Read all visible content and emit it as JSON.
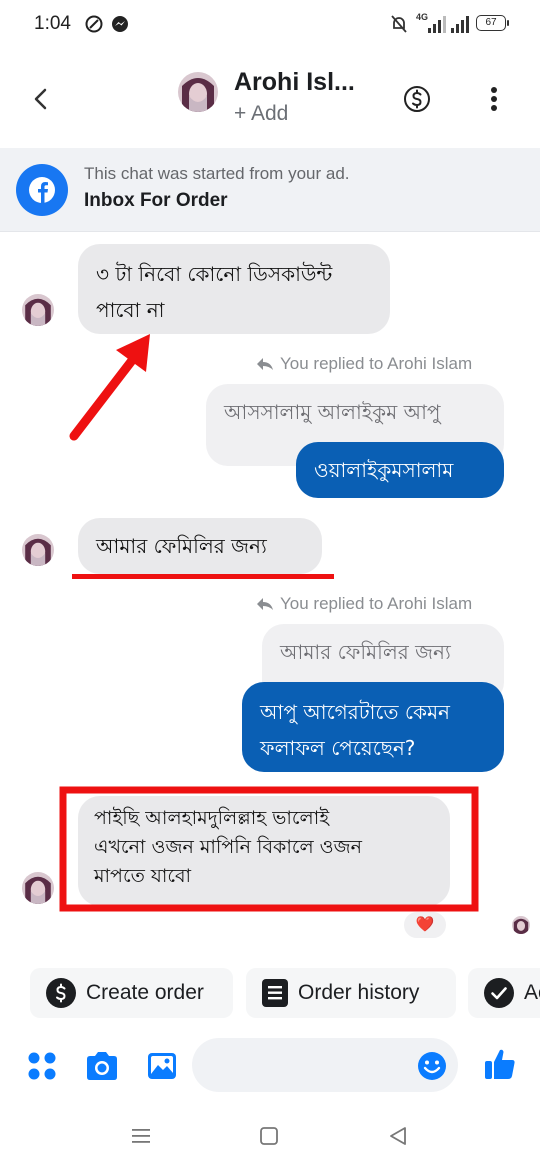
{
  "status_bar": {
    "time": "1:04",
    "network": "4G",
    "battery": "67"
  },
  "header": {
    "contact_name": "Arohi Isl...",
    "add_label": "+ Add"
  },
  "ad_banner": {
    "line1": "This chat was started from your ad.",
    "line2": "Inbox For Order"
  },
  "messages": {
    "m1": {
      "line1": "৩ টা নিবো কোনো ডিসকাউন্ট",
      "line2": "পাবো না"
    },
    "reply_note_1": "You replied to Arohi Islam",
    "quoted_1": "আসসালামু আলাইকুম আপু",
    "m2": "ওয়ালাইকুমসালাম",
    "m3": "আমার ফেমিলির জন্য",
    "reply_note_2": "You replied to Arohi Islam",
    "quoted_2": "আমার ফেমিলির জন্য",
    "m4": {
      "line1": "আপু আগেরটাতে কেমন",
      "line2": "ফলাফল পেয়েছেন?"
    },
    "m5": {
      "line1": "পাইছি আলহামদুলিল্লাহ  ভালোই",
      "line2": "এখনো ওজন মাপিনি বিকালে ওজন",
      "line3": "মাপতে যাবো"
    },
    "reaction": "❤️"
  },
  "quick_replies": {
    "create_order": "Create order",
    "order_history": "Order history",
    "third": "Ac"
  },
  "colors": {
    "accent": "#0a5fb4",
    "facebook_blue": "#1877f2",
    "annotation_red": "#ee1111"
  }
}
